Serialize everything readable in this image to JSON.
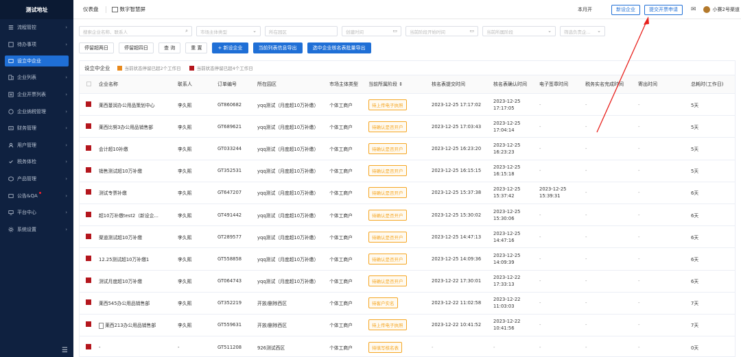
{
  "sidebar": {
    "logo": "测试地址",
    "items": [
      {
        "label": "流程管控",
        "icon": "flow-icon"
      },
      {
        "label": "待办事项",
        "icon": "todo-icon"
      },
      {
        "label": "设立中企业",
        "icon": "company-icon",
        "active": true
      },
      {
        "label": "企业列表",
        "icon": "list-icon"
      },
      {
        "label": "企业开票列表",
        "icon": "invoice-icon"
      },
      {
        "label": "企业纳税管理",
        "icon": "tax-icon"
      },
      {
        "label": "财务管理",
        "icon": "finance-icon"
      },
      {
        "label": "用户管理",
        "icon": "user-icon"
      },
      {
        "label": "税务体检",
        "icon": "check-icon"
      },
      {
        "label": "产品管理",
        "icon": "product-icon"
      },
      {
        "label": "公告&QA",
        "icon": "notice-icon",
        "dot": true
      },
      {
        "label": "平台中心",
        "icon": "platform-icon"
      },
      {
        "label": "系统设置",
        "icon": "settings-icon"
      }
    ],
    "collapse_icon": "menu-collapse-icon"
  },
  "topbar": {
    "tab1": "仪表盘",
    "tab2": "数字智慧屏",
    "month": "本月开",
    "new_company_btn": "新设企业",
    "invoice_apply_btn": "提交开票申请",
    "user_name": "小赛2号渠道"
  },
  "filters": {
    "search_placeholder": "搜索企业名称、联系人",
    "entity_type_placeholder": "市场主体类型",
    "park_placeholder": "所在园区",
    "create_time_placeholder": "创建时间",
    "stage_start_placeholder": "当前阶段开始时间",
    "stage_placeholder": "当前所属阶段",
    "filter_owner_placeholder": "筛选负责企..."
  },
  "buttons": {
    "overdue2": "停留超两日",
    "overdue4": "停留超四日",
    "query": "查 询",
    "reset": "重 置",
    "add": "+ 新设企业",
    "export_list": "当前列表信息导出",
    "export_selected": "选中企业核名表批量导出"
  },
  "legend": {
    "title": "设立中企业",
    "item1": "当前状态停留已超2个工作日",
    "item2": "当前状态停留已超4个工作日",
    "color1": "#e8891c",
    "color2": "#b4161d"
  },
  "table": {
    "headers": [
      "企业名称",
      "联系人",
      "订单编号",
      "所在园区",
      "市场主体类型",
      "当前所属阶段 ⇕",
      "核名表提交时间",
      "核名表确认时间",
      "电子签章时间",
      "税务实名完成时间",
      "寄出时间",
      "总耗时(工作日)"
    ],
    "rows": [
      {
        "name": "莱西蔓润办公用品策划中心",
        "contact": "李久熙",
        "order": "GT860682",
        "park": "yqq测试（月度超10万补缴）",
        "type": "个体工商户",
        "stage": "待上传电子执照",
        "submit": "2023-12-25 17:17:02",
        "confirm": "2023-12-25 17:17:05",
        "sign": "-",
        "tax": "-",
        "ship": "-",
        "total": "5天"
      },
      {
        "name": "莱西比努3办公用品销售部",
        "contact": "李久熙",
        "order": "GT689621",
        "park": "yqq测试（月度超10万补缴）",
        "type": "个体工商户",
        "stage": "待确认是否开户",
        "submit": "2023-12-25 17:03:43",
        "confirm": "2023-12-25 17:04:14",
        "sign": "-",
        "tax": "-",
        "ship": "-",
        "total": "5天"
      },
      {
        "name": "会计超10补缴",
        "contact": "李久熙",
        "order": "GT033244",
        "park": "yqq测试（月度超10万补缴）",
        "type": "个体工商户",
        "stage": "待确认是否开户",
        "submit": "2023-12-25 16:23:20",
        "confirm": "2023-12-25 16:23:23",
        "sign": "-",
        "tax": "-",
        "ship": "-",
        "total": "5天"
      },
      {
        "name": "销售测试超10万补缴",
        "contact": "李久熙",
        "order": "GT352531",
        "park": "yqq测试（月度超10万补缴）",
        "type": "个体工商户",
        "stage": "待确认是否开户",
        "submit": "2023-12-25 16:15:15",
        "confirm": "2023-12-25 16:15:18",
        "sign": "-",
        "tax": "-",
        "ship": "-",
        "total": "5天"
      },
      {
        "name": "测试专票补缴",
        "contact": "李久熙",
        "order": "GT647207",
        "park": "yqq测试（月度超10万补缴）",
        "type": "个体工商户",
        "stage": "待确认是否开户",
        "submit": "2023-12-25 15:37:38",
        "confirm": "2023-12-25 15:37:42",
        "sign": "2023-12-25 15:39:31",
        "tax": "-",
        "ship": "-",
        "total": "6天"
      },
      {
        "name": "超10万补缴test2（新设企...",
        "contact": "李久熙",
        "order": "GT491442",
        "park": "yqq测试（月度超10万补缴）",
        "type": "个体工商户",
        "stage": "待确认是否开户",
        "submit": "2023-12-25 15:30:02",
        "confirm": "2023-12-25 15:30:06",
        "sign": "-",
        "tax": "-",
        "ship": "-",
        "total": "6天"
      },
      {
        "name": "渠道测试超10万补缴",
        "contact": "李久熙",
        "order": "GT289577",
        "park": "yqq测试（月度超10万补缴）",
        "type": "个体工商户",
        "stage": "待确认是否开户",
        "submit": "2023-12-25 14:47:13",
        "confirm": "2023-12-25 14:47:16",
        "sign": "-",
        "tax": "-",
        "ship": "-",
        "total": "6天"
      },
      {
        "name": "12.25测试超10万补缴1",
        "contact": "李久熙",
        "order": "GT558858",
        "park": "yqq测试（月度超10万补缴）",
        "type": "个体工商户",
        "stage": "待确认是否开户",
        "submit": "2023-12-25 14:09:36",
        "confirm": "2023-12-25 14:09:39",
        "sign": "-",
        "tax": "-",
        "ship": "-",
        "total": "6天"
      },
      {
        "name": "测试月度超10万补缴",
        "contact": "李久熙",
        "order": "GT064743",
        "park": "yqq测试（月度超10万补缴）",
        "type": "个体工商户",
        "stage": "待确认是否开户",
        "submit": "2023-12-22 17:30:01",
        "confirm": "2023-12-22 17:33:13",
        "sign": "-",
        "tax": "-",
        "ship": "-",
        "total": "6天"
      },
      {
        "name": "莱西545办公用品销售部",
        "contact": "李久熙",
        "order": "GT352219",
        "park": "开放/删除西区",
        "type": "个体工商户",
        "stage": "待客户实名",
        "submit": "2023-12-22 11:02:58",
        "confirm": "2023-12-22 11:03:03",
        "sign": "-",
        "tax": "-",
        "ship": "-",
        "total": "7天"
      },
      {
        "name": "莱西213办公用品销售部",
        "contact": "李久熙",
        "order": "GT559631",
        "park": "开放/删除西区",
        "type": "个体工商户",
        "stage": "待上传电子执照",
        "submit": "2023-12-22 10:41:52",
        "confirm": "2023-12-22 10:41:56",
        "sign": "-",
        "tax": "-",
        "ship": "-",
        "total": "7天",
        "doc": true
      },
      {
        "name": "-",
        "contact": "-",
        "order": "GT511208",
        "park": "926测试西区",
        "type": "个体工商户",
        "stage": "待填写核名表",
        "submit": "-",
        "confirm": "-",
        "sign": "-",
        "tax": "-",
        "ship": "-",
        "total": "0天"
      }
    ]
  },
  "annotation": {
    "arrow_color": "#e8201c"
  }
}
